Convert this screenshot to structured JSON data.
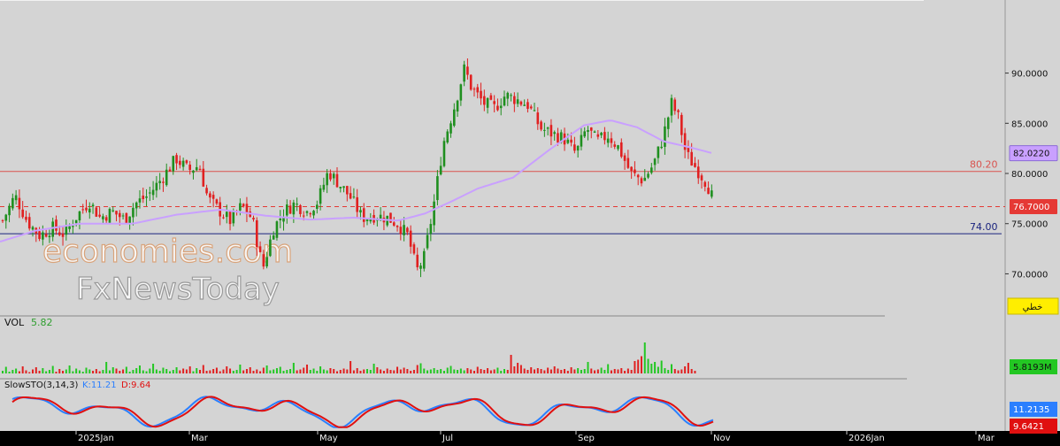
{
  "chart_data": {
    "type": "candlestick",
    "price_axis": {
      "ticks": [
        "90.0000",
        "85.0000",
        "80.0000",
        "75.0000",
        "70.0000"
      ],
      "values": [
        90,
        85,
        80,
        75,
        70
      ],
      "range": [
        66.6,
        96.4
      ]
    },
    "time_axis": {
      "labels": [
        "2025Jan",
        "Mar",
        "May",
        "Jul",
        "Sep",
        "Nov",
        "2026Jan",
        "Mar"
      ]
    },
    "horizontal_lines": [
      {
        "value": 80.2,
        "label": "80.20",
        "color": "#d9534f",
        "style": "solid"
      },
      {
        "value": 74.0,
        "label": "74.00",
        "color": "#1a237e",
        "style": "solid"
      },
      {
        "value": 76.7,
        "label": "76.7000",
        "color": "#e53935",
        "style": "dashed"
      }
    ],
    "moving_average": {
      "last_value": "82.0220",
      "color": "#c9a0ff"
    },
    "last_price": "76.7000",
    "close_path": [
      [
        0,
        75.3
      ],
      [
        14,
        77.8
      ],
      [
        28,
        75.2
      ],
      [
        42,
        73.8
      ],
      [
        56,
        74.6
      ],
      [
        70,
        73.9
      ],
      [
        84,
        75.8
      ],
      [
        98,
        77.2
      ],
      [
        110,
        75.6
      ],
      [
        124,
        76.2
      ],
      [
        138,
        75.4
      ],
      [
        150,
        77.0
      ],
      [
        164,
        77.8
      ],
      [
        180,
        79.5
      ],
      [
        196,
        81.5
      ],
      [
        210,
        80.3
      ],
      [
        222,
        80.8
      ],
      [
        232,
        77.5
      ],
      [
        246,
        76.2
      ],
      [
        258,
        75.2
      ],
      [
        270,
        76.8
      ],
      [
        282,
        75.5
      ],
      [
        294,
        70.5
      ],
      [
        306,
        74.5
      ],
      [
        318,
        76.2
      ],
      [
        330,
        77.0
      ],
      [
        344,
        76.2
      ],
      [
        356,
        77.2
      ],
      [
        368,
        80.2
      ],
      [
        382,
        78.8
      ],
      [
        394,
        77.5
      ],
      [
        406,
        75.6
      ],
      [
        420,
        75.8
      ],
      [
        434,
        75.6
      ],
      [
        446,
        75.0
      ],
      [
        458,
        73.8
      ],
      [
        468,
        70.3
      ],
      [
        476,
        71.5
      ],
      [
        486,
        76.2
      ],
      [
        498,
        83.0
      ],
      [
        510,
        86.5
      ],
      [
        522,
        90.5
      ],
      [
        530,
        88.5
      ],
      [
        544,
        87.0
      ],
      [
        556,
        86.5
      ],
      [
        568,
        87.8
      ],
      [
        580,
        87.4
      ],
      [
        594,
        86.8
      ],
      [
        608,
        84.5
      ],
      [
        620,
        84.0
      ],
      [
        634,
        83.5
      ],
      [
        648,
        82.0
      ],
      [
        660,
        84.5
      ],
      [
        672,
        83.2
      ],
      [
        684,
        83.8
      ],
      [
        696,
        82.6
      ],
      [
        710,
        80.0
      ],
      [
        724,
        79.3
      ],
      [
        736,
        81.0
      ],
      [
        746,
        83.5
      ],
      [
        756,
        87.0
      ],
      [
        764,
        85.5
      ],
      [
        772,
        82.0
      ],
      [
        784,
        80.5
      ],
      [
        796,
        79.0
      ],
      [
        806,
        76.7
      ]
    ],
    "ma_path": [
      [
        0,
        73.2
      ],
      [
        40,
        74.3
      ],
      [
        90,
        75.0
      ],
      [
        150,
        75.0
      ],
      [
        200,
        75.9
      ],
      [
        250,
        76.4
      ],
      [
        300,
        75.8
      ],
      [
        350,
        75.4
      ],
      [
        400,
        75.6
      ],
      [
        450,
        75.3
      ],
      [
        480,
        76.0
      ],
      [
        510,
        77.2
      ],
      [
        540,
        78.5
      ],
      [
        580,
        79.6
      ],
      [
        620,
        82.3
      ],
      [
        660,
        84.8
      ],
      [
        690,
        85.3
      ],
      [
        720,
        84.6
      ],
      [
        750,
        83.2
      ],
      [
        780,
        82.6
      ],
      [
        806,
        82.0
      ]
    ],
    "volume": {
      "label": "VOL",
      "value_label": "5.82",
      "last_value": "5.8193M",
      "range": [
        0,
        10
      ],
      "bars": [
        0.6,
        1.5,
        0.4,
        0.8,
        1.1,
        0.5,
        1.6,
        0.7,
        0.3,
        0.9,
        1.4,
        0.6,
        1.2,
        0.5,
        0.8,
        1.7,
        0.4,
        1.0,
        0.6,
        0.9,
        1.8,
        0.5,
        1.1,
        0.7,
        0.4,
        1.3,
        0.9,
        0.6,
        1.0,
        0.5,
        0.8,
        2.6,
        0.7,
        1.4,
        1.1,
        0.6,
        0.9,
        1.5,
        0.4,
        0.8,
        1.2,
        1.8,
        0.7,
        0.5,
        1.1,
        2.2,
        0.9,
        0.6,
        1.3,
        1.0,
        0.5,
        0.8,
        1.4,
        0.7,
        1.1,
        0.9,
        1.6,
        0.5,
        1.2,
        0.8,
        1.9,
        0.6,
        0.7,
        1.0,
        1.3,
        0.5,
        0.9,
        1.6,
        1.1,
        0.6,
        0.8,
        2.0,
        0.7,
        1.0,
        1.4,
        0.6,
        0.9,
        0.5,
        1.3,
        1.8,
        0.7,
        0.9,
        1.2,
        1.5,
        0.6,
        0.8,
        1.0,
        2.4,
        0.7,
        0.9,
        1.3,
        2.0,
        0.8,
        1.1,
        0.6,
        1.6,
        0.9,
        0.7,
        1.2,
        1.0,
        0.5,
        0.8,
        1.1,
        0.9,
        2.8,
        0.7,
        1.2,
        0.6,
        0.9,
        1.0,
        0.8,
        2.2,
        1.4,
        0.9,
        0.6,
        1.1,
        0.8,
        0.7,
        1.5,
        0.9,
        1.3,
        1.0,
        0.6,
        0.8,
        1.9,
        2.3,
        1.1,
        0.7,
        0.9,
        1.2,
        0.8,
        1.0,
        0.6,
        1.3,
        1.7,
        0.9,
        0.8,
        1.1,
        0.7,
        1.2,
        0.9,
        0.6,
        1.5,
        1.0,
        0.8,
        1.2,
        0.7,
        0.9,
        1.3,
        0.6,
        1.0,
        0.8,
        4.2,
        1.6,
        2.4,
        1.9,
        1.1,
        0.8,
        1.4,
        0.9,
        1.2,
        1.0,
        0.7,
        1.3,
        0.9,
        1.6,
        1.1,
        0.8,
        1.0,
        0.6,
        1.4,
        0.9,
        1.2,
        0.8,
        1.0,
        2.6,
        1.1,
        0.7,
        0.9,
        1.3,
        0.8,
        2.1,
        0.7,
        1.0,
        0.9,
        1.2,
        0.6,
        1.1,
        0.8,
        2.8,
        3.1,
        3.9,
        7.0,
        3.3,
        2.2,
        2.6,
        1.5,
        2.9,
        1.2,
        0.8,
        2.1,
        1.0,
        0.7,
        0.9,
        1.6,
        2.4,
        1.0,
        0.6
      ]
    },
    "stochastic": {
      "label": "SlowSTO(3,14,3)",
      "k_label": "K:11.21",
      "d_label": "D:9.64",
      "k_value": "11.2135",
      "d_value": "9.6421",
      "range": [
        0,
        100
      ],
      "k_color": "#2a7fff",
      "d_color": "#e01010"
    },
    "watermark": {
      "line1": "economies.com",
      "line2": "FxNewsToday"
    },
    "badge": "خطي"
  }
}
